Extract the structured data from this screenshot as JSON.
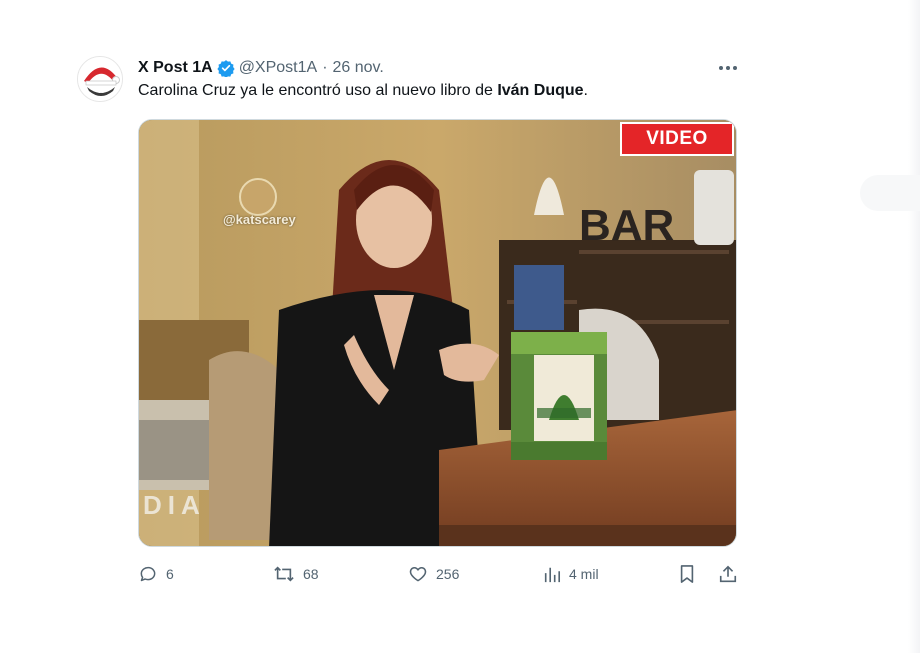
{
  "post": {
    "author_name": "X Post 1A",
    "handle": "@XPost1A",
    "separator": "·",
    "date": "26 nov.",
    "text_before": "Carolina Cruz ya le encontró uso al nuevo libro de ",
    "text_bold": "Iván Duque",
    "text_after": "."
  },
  "media": {
    "badge": "VIDEO",
    "watermark": "@katscarey",
    "overlay_text": "DIA"
  },
  "actions": {
    "replies": "6",
    "reposts": "68",
    "likes": "256",
    "views": "4 mil"
  },
  "colors": {
    "verified": "#1d9bf0",
    "badge": "#e42528",
    "muted": "#536471"
  },
  "icons": {
    "verified": "verified-badge-icon",
    "more": "more-icon",
    "reply": "reply-icon",
    "repost": "repost-icon",
    "like": "like-icon",
    "views": "views-icon",
    "bookmark": "bookmark-icon",
    "share": "share-icon"
  }
}
